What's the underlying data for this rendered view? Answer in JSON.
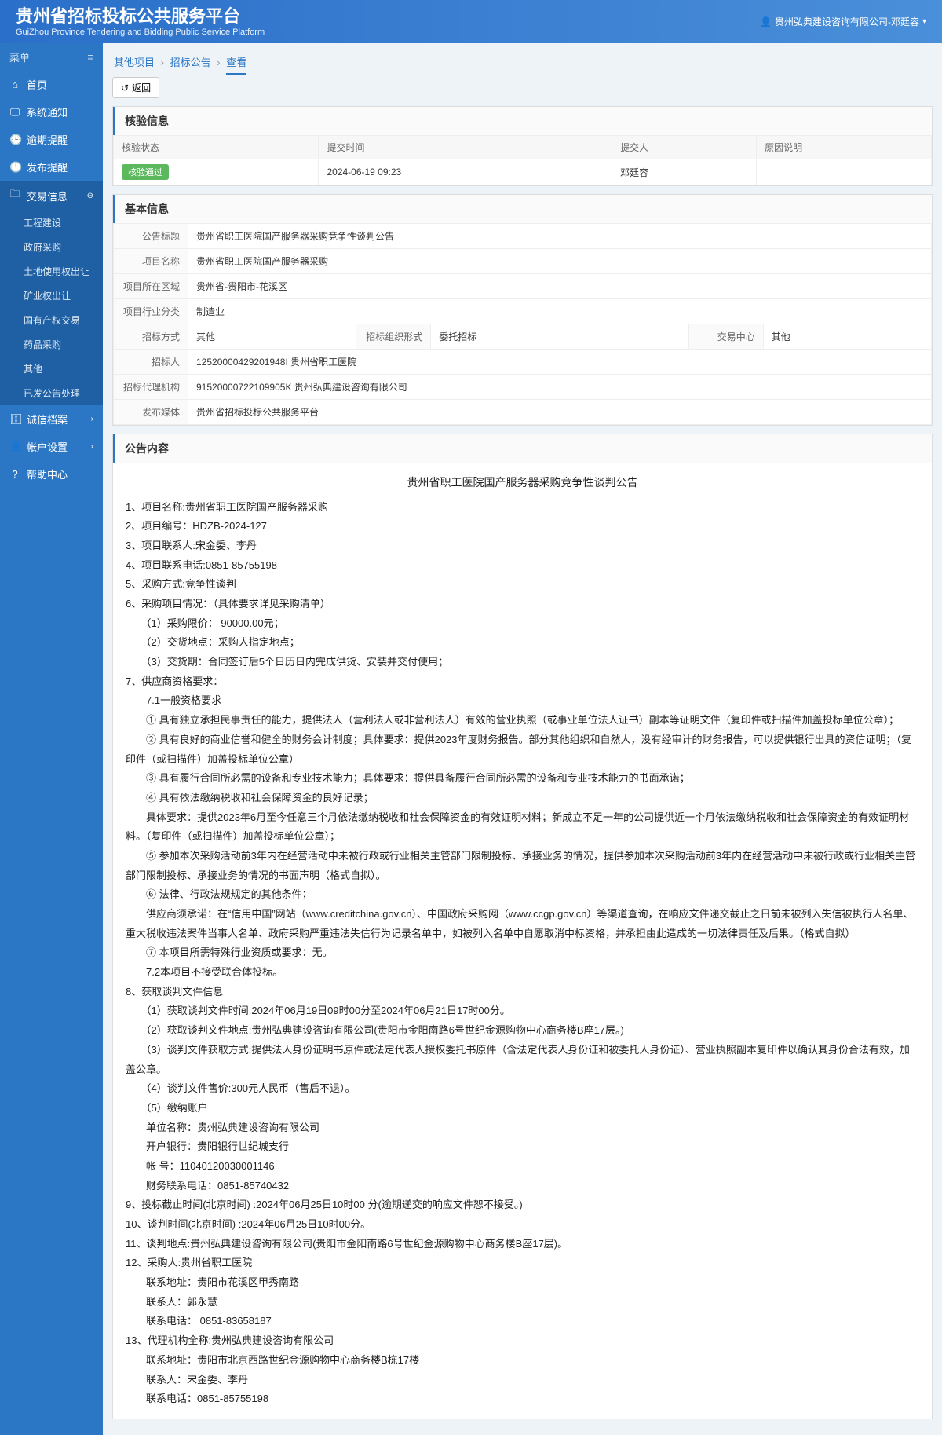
{
  "header": {
    "title": "贵州省招标投标公共服务平台",
    "subtitle": "GuiZhou Province Tendering and Bidding Public Service Platform",
    "user": "贵州弘典建设咨询有限公司-邓廷容"
  },
  "sidebar": {
    "menu_label": "菜单",
    "items": [
      {
        "icon": "home",
        "label": "首页"
      },
      {
        "icon": "monitor",
        "label": "系统通知"
      },
      {
        "icon": "clock",
        "label": "逾期提醒"
      },
      {
        "icon": "clock",
        "label": "发布提醒"
      },
      {
        "icon": "folder",
        "label": "交易信息",
        "active": true,
        "expand": true,
        "children": [
          {
            "label": "工程建设"
          },
          {
            "label": "政府采购"
          },
          {
            "label": "土地使用权出让"
          },
          {
            "label": "矿业权出让"
          },
          {
            "label": "国有产权交易"
          },
          {
            "label": "药品采购"
          },
          {
            "label": "其他"
          },
          {
            "label": "已发公告处理"
          }
        ]
      },
      {
        "icon": "archive",
        "label": "诚信档案",
        "expand": true
      },
      {
        "icon": "user",
        "label": "帐户设置",
        "expand": true
      },
      {
        "icon": "help",
        "label": "帮助中心"
      }
    ]
  },
  "breadcrumb": [
    "其他项目",
    "招标公告",
    "查看"
  ],
  "back_label": "返回",
  "panels": {
    "verify": {
      "title": "核验信息",
      "headers": [
        "核验状态",
        "提交时间",
        "提交人",
        "原因说明"
      ],
      "row": {
        "status": "核验通过",
        "time": "2024-06-19 09:23",
        "person": "邓廷容",
        "reason": ""
      }
    },
    "basic": {
      "title": "基本信息",
      "rows": {
        "announce_title_label": "公告标题",
        "announce_title": "贵州省职工医院国产服务器采购竞争性谈判公告",
        "proj_name_label": "项目名称",
        "proj_name": "贵州省职工医院国产服务器采购",
        "region_label": "项目所在区域",
        "region": "贵州省-贵阳市-花溪区",
        "industry_label": "项目行业分类",
        "industry": "制造业",
        "bid_method_label": "招标方式",
        "bid_method": "其他",
        "org_form_label": "招标组织形式",
        "org_form": "委托招标",
        "center_label": "交易中心",
        "center": "其他",
        "tenderer_label": "招标人",
        "tenderer": "12520000429201948I 贵州省职工医院",
        "agency_label": "招标代理机构",
        "agency": "91520000722109905K 贵州弘典建设咨询有限公司",
        "media_label": "发布媒体",
        "media": "贵州省招标投标公共服务平台"
      }
    },
    "content": {
      "title": "公告内容",
      "doc_title": "贵州省职工医院国产服务器采购竞争性谈判公告",
      "lines": [
        "1、项目名称:贵州省职工医院国产服务器采购",
        "2、项目编号：HDZB-2024-127",
        "3、项目联系人:宋金委、李丹",
        "4、项目联系电话:0851-85755198",
        "5、采购方式:竞争性谈判",
        "6、采购项目情况：（具体要求详见采购清单）",
        "　　（1）采购限价： 90000.00元；",
        "　　（2）交货地点：采购人指定地点；",
        "　　（3）交货期：合同签订后5个日历日内完成供货、安装并交付使用；",
        "7、供应商资格要求：",
        "　　7.1一般资格要求",
        "　　① 具有独立承担民事责任的能力，提供法人（营利法人或非营利法人）有效的营业执照（或事业单位法人证书）副本等证明文件（复印件或扫描件加盖投标单位公章）；",
        "　　② 具有良好的商业信誉和健全的财务会计制度；具体要求：提供2023年度财务报告。部分其他组织和自然人，没有经审计的财务报告，可以提供银行出具的资信证明；（复印件（或扫描件）加盖投标单位公章）",
        "　　③ 具有履行合同所必需的设备和专业技术能力；具体要求：提供具备履行合同所必需的设备和专业技术能力的书面承诺；",
        "　　④ 具有依法缴纳税收和社会保障资金的良好记录；",
        "　　具体要求：提供2023年6月至今任意三个月依法缴纳税收和社会保障资金的有效证明材料；新成立不足一年的公司提供近一个月依法缴纳税收和社会保障资金的有效证明材料。（复印件（或扫描件）加盖投标单位公章）；",
        "　　⑤ 参加本次采购活动前3年内在经营活动中未被行政或行业相关主管部门限制投标、承接业务的情况，提供参加本次采购活动前3年内在经营活动中未被行政或行业相关主管部门限制投标、承接业务的情况的书面声明（格式自拟）。",
        "　　⑥ 法律、行政法规规定的其他条件；",
        "　　供应商须承诺：在“信用中国”网站（www.creditchina.gov.cn）、中国政府采购网（www.ccgp.gov.cn）等渠道查询，在响应文件递交截止之日前未被列入失信被执行人名单、重大税收违法案件当事人名单、政府采购严重违法失信行为记录名单中，如被列入名单中自愿取消中标资格，并承担由此造成的一切法律责任及后果。（格式自拟）",
        "　　⑦ 本项目所需特殊行业资质或要求：无。",
        "　　7.2本项目不接受联合体投标。",
        "8、获取谈判文件信息",
        "　　（1）获取谈判文件时间:2024年06月19日09时00分至2024年06月21日17时00分。",
        "　　（2）获取谈判文件地点:贵州弘典建设咨询有限公司(贵阳市金阳南路6号世纪金源购物中心商务楼B座17层。)",
        "　　（3）谈判文件获取方式:提供法人身份证明书原件或法定代表人授权委托书原件（含法定代表人身份证和被委托人身份证）、营业执照副本复印件以确认其身份合法有效，加盖公章。",
        "　　（4）谈判文件售价:300元人民币（售后不退）。",
        "　　（5）缴纳账户",
        "　　单位名称：贵州弘典建设咨询有限公司",
        "　　开户银行：贵阳银行世纪城支行",
        "　　帐          号：11040120030001146",
        "　　财务联系电话：0851-85740432",
        "9、投标截止时间(北京时间) :2024年06月25日10时00 分(逾期递交的响应文件恕不接受。)",
        "10、谈判时间(北京时间) :2024年06月25日10时00分。",
        "11、谈判地点:贵州弘典建设咨询有限公司(贵阳市金阳南路6号世纪金源购物中心商务楼B座17层)。",
        "12、采购人:贵州省职工医院",
        "　　联系地址：贵阳市花溪区甲秀南路",
        "　　联系人：郭永慧",
        "　　联系电话：   0851-83658187",
        "13、代理机构全称:贵州弘典建设咨询有限公司",
        "　　联系地址：贵阳市北京西路世纪金源购物中心商务楼B栋17楼",
        "　　联系人：宋金委、李丹",
        "　　联系电话：0851-85755198"
      ]
    }
  }
}
